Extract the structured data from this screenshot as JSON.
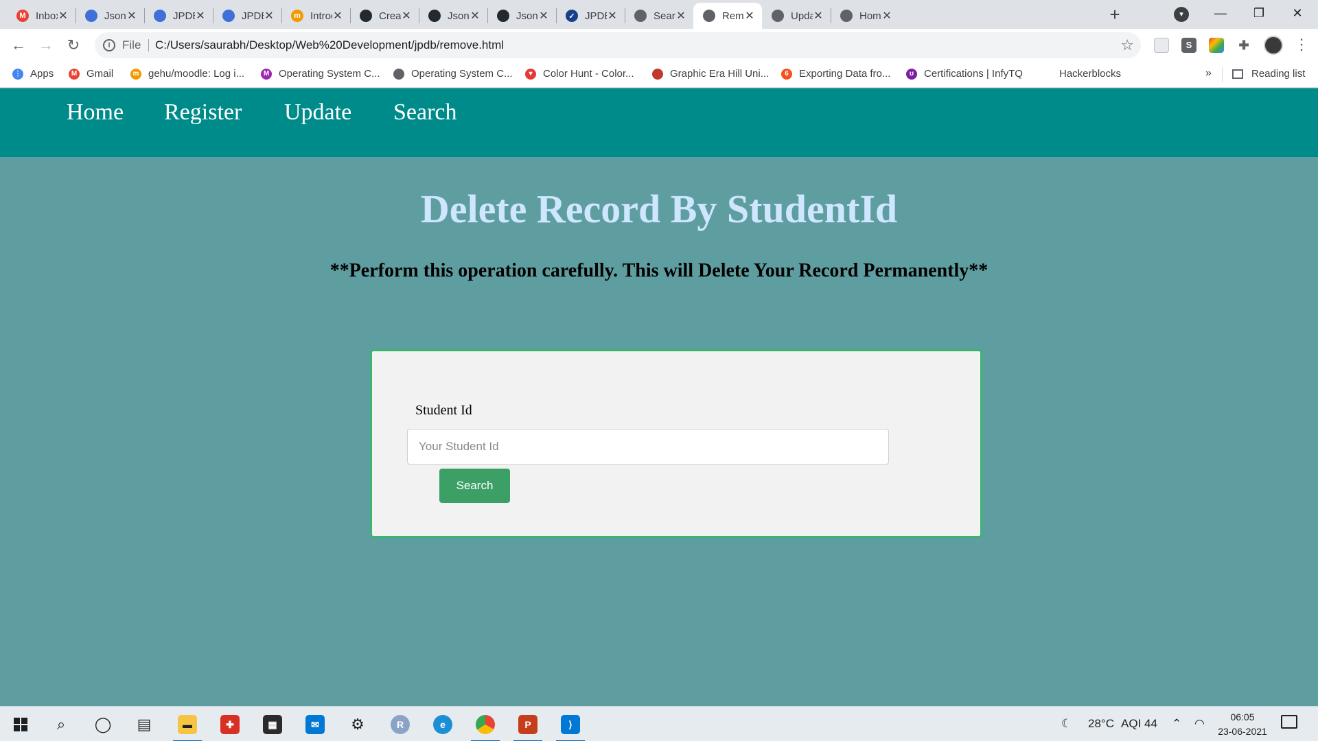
{
  "browser": {
    "tabs": [
      {
        "title": "Inbox",
        "icon": "gmail-icon",
        "color": "#ea4335",
        "glyph": "M"
      },
      {
        "title": "JsonPo",
        "icon": "jpdb-icon",
        "color": "#3f6fd8",
        "glyph": ""
      },
      {
        "title": "JPDB -",
        "icon": "jpdb-icon",
        "color": "#3f6fd8",
        "glyph": ""
      },
      {
        "title": "JPDB -",
        "icon": "jpdb-icon",
        "color": "#3f6fd8",
        "glyph": ""
      },
      {
        "title": "Introd",
        "icon": "moodle-icon",
        "color": "#f29900",
        "glyph": "m"
      },
      {
        "title": "Create",
        "icon": "github-icon",
        "color": "#24292e",
        "glyph": ""
      },
      {
        "title": "JsonPo",
        "icon": "github-icon",
        "color": "#24292e",
        "glyph": ""
      },
      {
        "title": "JsonPo",
        "icon": "github-icon",
        "color": "#24292e",
        "glyph": ""
      },
      {
        "title": "JPDB/",
        "icon": "check-circle-icon",
        "color": "#1a3f8a",
        "glyph": "✓"
      },
      {
        "title": "Search",
        "icon": "globe-icon",
        "color": "#5f6368",
        "glyph": ""
      },
      {
        "title": "Remo",
        "icon": "globe-icon",
        "color": "#5f6368",
        "glyph": ""
      },
      {
        "title": "Updat",
        "icon": "globe-icon",
        "color": "#5f6368",
        "glyph": ""
      },
      {
        "title": "Home",
        "icon": "globe-icon",
        "color": "#5f6368",
        "glyph": ""
      }
    ],
    "active_tab": 10,
    "address": {
      "scheme": "File",
      "url": "C:/Users/saurabh/Desktop/Web%20Development/jpdb/remove.html"
    },
    "bookmarks": [
      {
        "label": "Apps",
        "icon": "apps-grid-icon",
        "color": "#4285f4",
        "glyph": "⋮"
      },
      {
        "label": "Gmail",
        "icon": "gmail-icon",
        "color": "#ea4335",
        "glyph": "M"
      },
      {
        "label": "gehu/moodle: Log i...",
        "icon": "moodle-icon",
        "color": "#f29900",
        "glyph": "m"
      },
      {
        "label": "Operating System C...",
        "icon": "m-circle-icon",
        "color": "#9c27b0",
        "glyph": "M"
      },
      {
        "label": "Operating System C...",
        "icon": "globe-icon",
        "color": "#5f6368",
        "glyph": ""
      },
      {
        "label": "Color Hunt - Color...",
        "icon": "colorhunt-icon",
        "color": "#e53935",
        "glyph": "▾"
      },
      {
        "label": "Graphic Era Hill Uni...",
        "icon": "geu-icon",
        "color": "#c0392b",
        "glyph": ""
      },
      {
        "label": "Exporting Data fro...",
        "icon": "exporting-icon",
        "color": "#f4511e",
        "glyph": "6"
      },
      {
        "label": "Certifications | InfyTQ",
        "icon": "infytq-icon",
        "color": "#7b1fa2",
        "glyph": "ʊ"
      },
      {
        "label": "Hackerblocks",
        "icon": "",
        "color": "",
        "glyph": ""
      }
    ],
    "bookmarks_overflow": "»",
    "reading_list": "Reading list"
  },
  "nav": {
    "home": "Home",
    "register": "Register",
    "update": "Update",
    "search": "Search"
  },
  "page": {
    "heading": "Delete Record By StudentId",
    "warning": "**Perform this operation carefully. This will Delete Your Record Permanently**",
    "form": {
      "label": "Student Id",
      "input_value": "",
      "placeholder": "Your Student Id",
      "button": "Search"
    }
  },
  "colors": {
    "navbar": "#008b8b",
    "background": "#5f9ea0",
    "heading": "#cfe6ff",
    "card_border": "#3cb371",
    "button": "#3ca066"
  },
  "taskbar": {
    "weather": "28°C",
    "aqi": "AQI 44",
    "time": "06:05",
    "date": "23-06-2021"
  }
}
